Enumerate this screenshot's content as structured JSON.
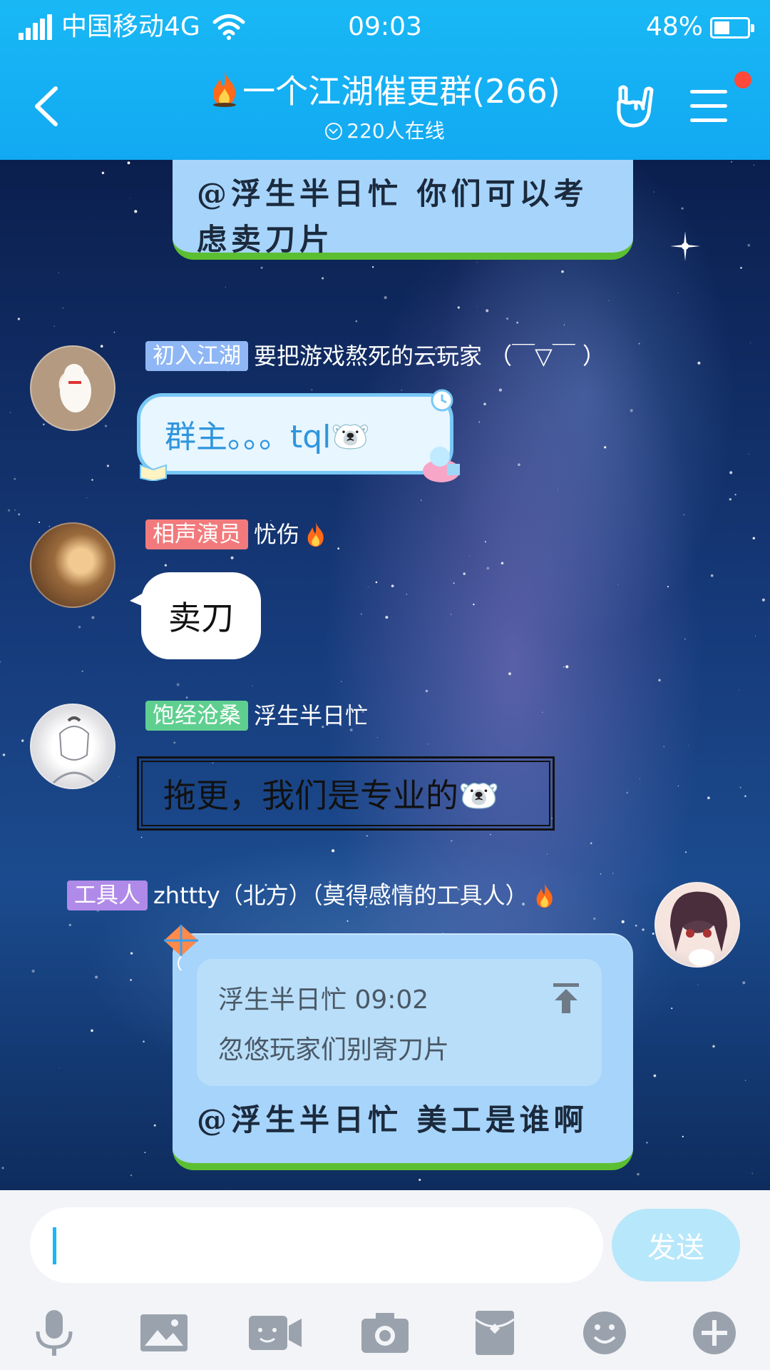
{
  "status_bar": {
    "carrier": "中国移动4G",
    "time": "09:03",
    "battery_percent": "48%",
    "battery_level": 0.48
  },
  "header": {
    "title": "一个江湖催更群(266)",
    "online": "220人在线",
    "menu_has_badge": true
  },
  "messages": [
    {
      "type": "theme",
      "text_line1": "@浮生半日忙 你们可以考",
      "text_line2": "虑卖刀片"
    },
    {
      "badge": "初入江湖",
      "nick": "要把游戏熬死的云玩家  （￣▽￣  ）",
      "text": "群主。。。tql🐻‍❄️"
    },
    {
      "badge": "相声演员",
      "nick": "忧伤",
      "text": "卖刀"
    },
    {
      "badge": "饱经沧桑",
      "nick": "浮生半日忙",
      "text": "拖更，我们是专业的🐻‍❄️"
    },
    {
      "badge": "工具人",
      "nick": "zhttty（北方）（莫得感情的工具人）",
      "quote_meta": "浮生半日忙 09:02",
      "quote_text": "忽悠玩家们别寄刀片",
      "text": "@浮生半日忙 美工是谁啊"
    }
  ],
  "composer": {
    "input_value": "",
    "send_label": "发送"
  },
  "toolbar": [
    "microphone-icon",
    "image-icon",
    "video-call-icon",
    "camera-icon",
    "red-envelope-icon",
    "emoji-icon",
    "plus-icon"
  ],
  "colors": {
    "header": "#12a9f2",
    "accent": "#19b8f5",
    "send_disabled": "#b7e7fa",
    "theme_bubble": "#a7d4fb",
    "notification": "#ff4a3a"
  }
}
